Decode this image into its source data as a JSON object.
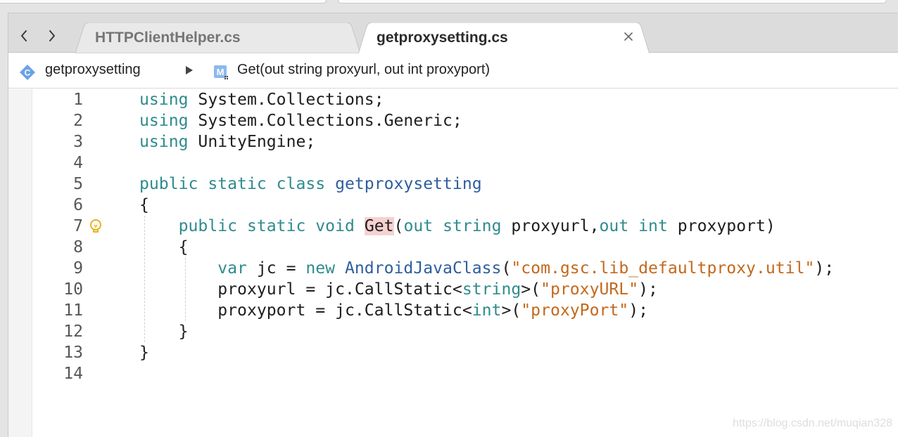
{
  "navigation": {
    "back_icon": "chevron-left-icon",
    "forward_icon": "chevron-right-icon"
  },
  "tabs": [
    {
      "label": "HTTPClientHelper.cs",
      "active": false
    },
    {
      "label": "getproxysetting.cs",
      "active": true,
      "close_icon": "close-icon"
    }
  ],
  "breadcrumb": {
    "class_icon": "class-icon",
    "class_icon_letter": "C",
    "class_name": "getproxysetting",
    "separator_icon": "triangle-right-icon",
    "method_icon": "method-icon",
    "method_icon_letter": "M",
    "method_signature": "Get(out string proxyurl, out int proxyport)"
  },
  "editor": {
    "line_numbers": [
      "1",
      "2",
      "3",
      "4",
      "5",
      "6",
      "7",
      "8",
      "9",
      "10",
      "11",
      "12",
      "13",
      "14"
    ],
    "code": [
      [
        {
          "t": "using",
          "c": "kw"
        },
        {
          "t": " System.Collections;",
          "c": ""
        }
      ],
      [
        {
          "t": "using",
          "c": "kw"
        },
        {
          "t": " System.Collections.Generic;",
          "c": ""
        }
      ],
      [
        {
          "t": "using",
          "c": "kw"
        },
        {
          "t": " UnityEngine;",
          "c": ""
        }
      ],
      [],
      [
        {
          "t": "public",
          "c": "kw"
        },
        {
          "t": " ",
          "c": ""
        },
        {
          "t": "static",
          "c": "kw"
        },
        {
          "t": " ",
          "c": ""
        },
        {
          "t": "class",
          "c": "kw"
        },
        {
          "t": " ",
          "c": ""
        },
        {
          "t": "getproxysetting",
          "c": "ty"
        }
      ],
      [
        {
          "t": "{",
          "c": ""
        }
      ],
      [
        {
          "t": "    ",
          "c": ""
        },
        {
          "t": "public",
          "c": "kw"
        },
        {
          "t": " ",
          "c": ""
        },
        {
          "t": "static",
          "c": "kw"
        },
        {
          "t": " ",
          "c": ""
        },
        {
          "t": "void",
          "c": "kw"
        },
        {
          "t": " ",
          "c": ""
        },
        {
          "t": "Get",
          "c": "hl"
        },
        {
          "t": "(",
          "c": ""
        },
        {
          "t": "out",
          "c": "kw"
        },
        {
          "t": " ",
          "c": ""
        },
        {
          "t": "string",
          "c": "kw"
        },
        {
          "t": " proxyurl,",
          "c": ""
        },
        {
          "t": "out",
          "c": "kw"
        },
        {
          "t": " ",
          "c": ""
        },
        {
          "t": "int",
          "c": "kw"
        },
        {
          "t": " proxyport)",
          "c": ""
        }
      ],
      [
        {
          "t": "    {",
          "c": ""
        }
      ],
      [
        {
          "t": "        ",
          "c": ""
        },
        {
          "t": "var",
          "c": "kw"
        },
        {
          "t": " jc = ",
          "c": ""
        },
        {
          "t": "new",
          "c": "kw"
        },
        {
          "t": " ",
          "c": ""
        },
        {
          "t": "AndroidJavaClass",
          "c": "ty"
        },
        {
          "t": "(",
          "c": ""
        },
        {
          "t": "\"com.gsc.lib_defaultproxy.util\"",
          "c": "str"
        },
        {
          "t": ");",
          "c": ""
        }
      ],
      [
        {
          "t": "        proxyurl = jc.CallStatic<",
          "c": ""
        },
        {
          "t": "string",
          "c": "kw"
        },
        {
          "t": ">(",
          "c": ""
        },
        {
          "t": "\"proxyURL\"",
          "c": "str"
        },
        {
          "t": ");",
          "c": ""
        }
      ],
      [
        {
          "t": "        proxyport = jc.CallStatic<",
          "c": ""
        },
        {
          "t": "int",
          "c": "kw"
        },
        {
          "t": ">(",
          "c": ""
        },
        {
          "t": "\"proxyPort\"",
          "c": "str"
        },
        {
          "t": ");",
          "c": ""
        }
      ],
      [
        {
          "t": "    }",
          "c": ""
        }
      ],
      [
        {
          "t": "}",
          "c": ""
        }
      ],
      []
    ],
    "lightbulb_icon": "lightbulb-icon"
  },
  "watermark": "https://blog.csdn.net/muqian328"
}
